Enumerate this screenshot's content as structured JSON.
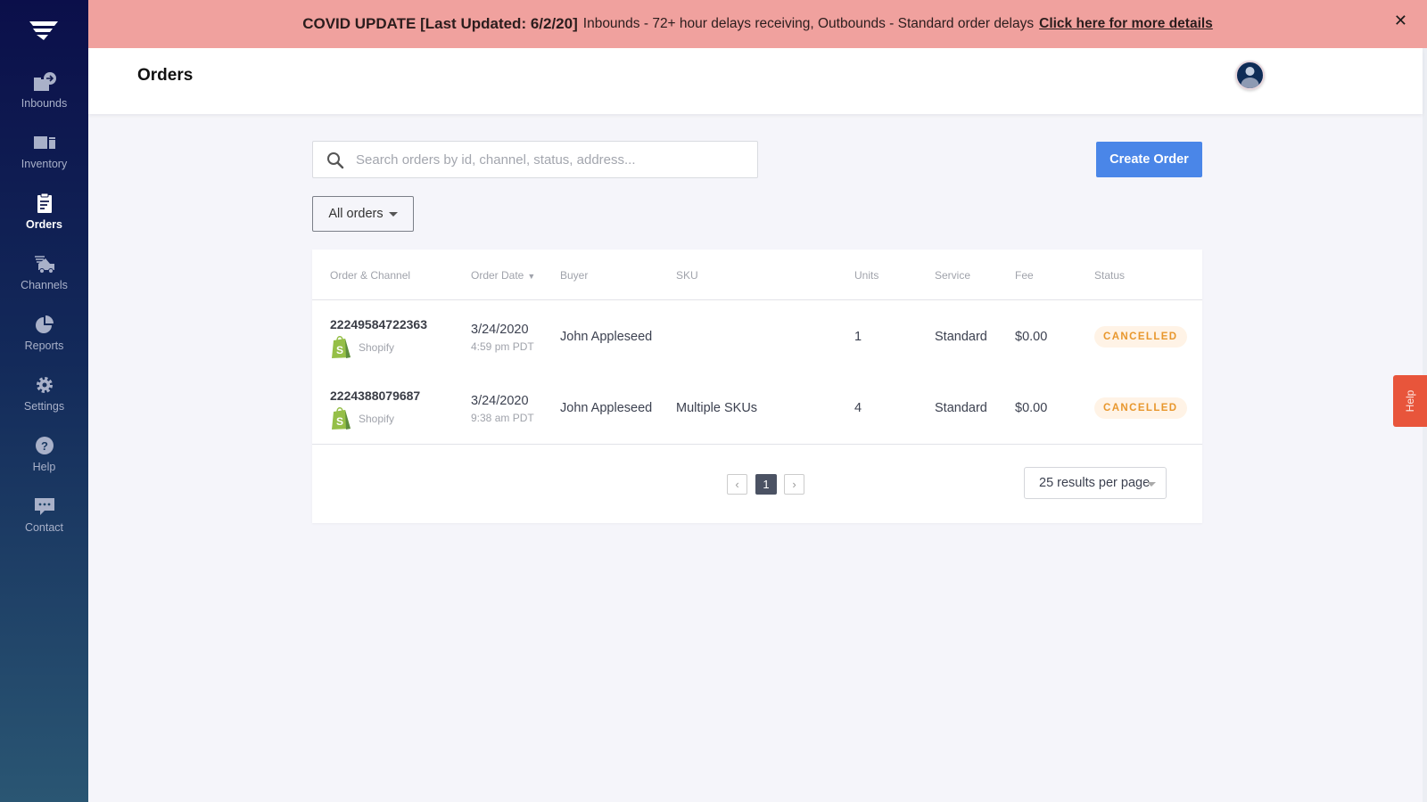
{
  "sidebar": {
    "items": [
      {
        "label": "Inbounds",
        "icon": "inbound-box-icon",
        "active": false
      },
      {
        "label": "Inventory",
        "icon": "inventory-icon",
        "active": false
      },
      {
        "label": "Orders",
        "icon": "clipboard-icon",
        "active": true
      },
      {
        "label": "Channels",
        "icon": "truck-icon",
        "active": false
      },
      {
        "label": "Reports",
        "icon": "pie-chart-icon",
        "active": false
      },
      {
        "label": "Settings",
        "icon": "gear-icon",
        "active": false
      },
      {
        "label": "Help",
        "icon": "question-circle-icon",
        "active": false
      },
      {
        "label": "Contact",
        "icon": "chat-bubble-icon",
        "active": false
      }
    ]
  },
  "banner": {
    "title": "COVID UPDATE [Last Updated: 6/2/20]",
    "text": "Inbounds - 72+ hour delays receiving, Outbounds - Standard order delays",
    "link": "Click here for more details",
    "close": "✕"
  },
  "header": {
    "title": "Orders"
  },
  "search": {
    "placeholder": "Search orders by id, channel, status, address...",
    "value": ""
  },
  "toolbar": {
    "create_label": "Create Order",
    "filter_label": "All orders"
  },
  "table": {
    "columns": [
      "Order & Channel",
      "Order Date",
      "Buyer",
      "SKU",
      "Units",
      "Service",
      "Fee",
      "Status"
    ],
    "sort_indicator": "▼",
    "rows": [
      {
        "order_id": "22249584722363",
        "channel": "Shopify",
        "date": "3/24/2020",
        "time": "4:59 pm PDT",
        "buyer": "John Appleseed",
        "sku": "",
        "units": "1",
        "service": "Standard",
        "fee": "$0.00",
        "status": "CANCELLED"
      },
      {
        "order_id": "2224388079687",
        "channel": "Shopify",
        "date": "3/24/2020",
        "time": "9:38 am PDT",
        "buyer": "John Appleseed",
        "sku": "Multiple SKUs",
        "units": "4",
        "service": "Standard",
        "fee": "$0.00",
        "status": "CANCELLED"
      }
    ]
  },
  "pagination": {
    "prev": "‹",
    "current": "1",
    "next": "›",
    "per_page": "25 results per page"
  },
  "help_tab": {
    "label": "Help"
  },
  "colors": {
    "accent": "#4a86e8",
    "banner": "#f0a19e",
    "status_cancelled": "#e8972d",
    "help_tab": "#e8553b"
  }
}
